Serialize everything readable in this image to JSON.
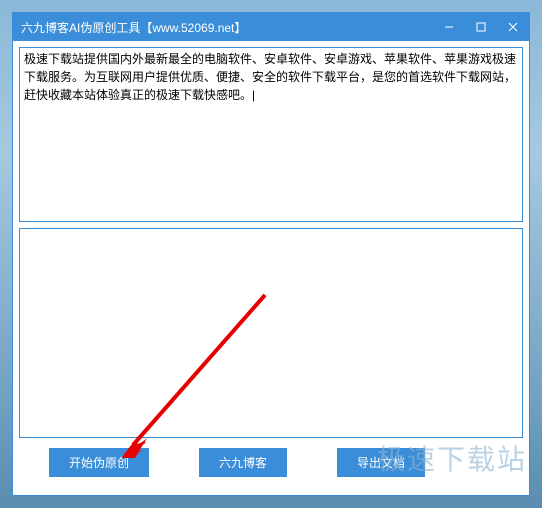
{
  "window": {
    "title": "六九博客AI伪原创工具【www.52069.net】"
  },
  "input": {
    "value": "极速下载站提供国内外最新最全的电脑软件、安卓软件、安卓游戏、苹果软件、苹果游戏极速下载服务。为互联网用户提供优质、便捷、安全的软件下载平台，是您的首选软件下载网站，赶快收藏本站体验真正的极速下载快感吧。|"
  },
  "output": {
    "value": ""
  },
  "buttons": {
    "start": "开始伪原创",
    "blog": "六九博客",
    "export": "导出文档"
  },
  "watermark": "极速下载站"
}
